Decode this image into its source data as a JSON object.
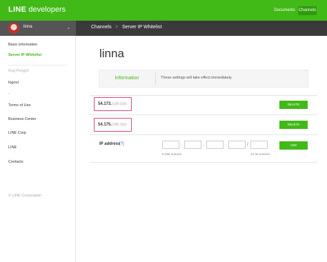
{
  "header": {
    "logo_brand": "LINE",
    "logo_text": "developers",
    "nav_docs": "Documents",
    "nav_channels": "Channels"
  },
  "user": {
    "name": "linna",
    "avatar_icon": "avatar-image",
    "menu_icon": "chevron-down-icon"
  },
  "breadcrumb": {
    "first": "Channels",
    "separator": ">",
    "second": "Server IP Whitelist"
  },
  "sidebar": {
    "basic_info": "Basic information",
    "server_ip": "Server IP Whitelist",
    "account": "Kug Pongph",
    "logout": "logout",
    "dash": "-",
    "terms": "Terms of Use",
    "business": "Business Center",
    "line_corp": "LINE Corp",
    "line": "LINE",
    "contacts": "Contacts",
    "copyright": "© LINE Corporation"
  },
  "main": {
    "title": "linna",
    "info_label": "Information",
    "info_text": "These settings will take effect immediately.",
    "whitelist": [
      {
        "prefix": "54.173.",
        "hidden": "126.155",
        "delete_label": "DELETE"
      },
      {
        "prefix": "54.175.",
        "hidden": "236.152",
        "delete_label": "DELETE"
      }
    ],
    "ip_label": "IP address",
    "help": "[?]",
    "dot": ".",
    "slash": "/",
    "octet_hint": "0-255 numeric",
    "cidr_hint": "24-30 numeric",
    "add_label": "ADD"
  },
  "colors": {
    "accent": "#41b917",
    "highlight_border": "#e0457b",
    "subbar": "#3a3a3a"
  }
}
